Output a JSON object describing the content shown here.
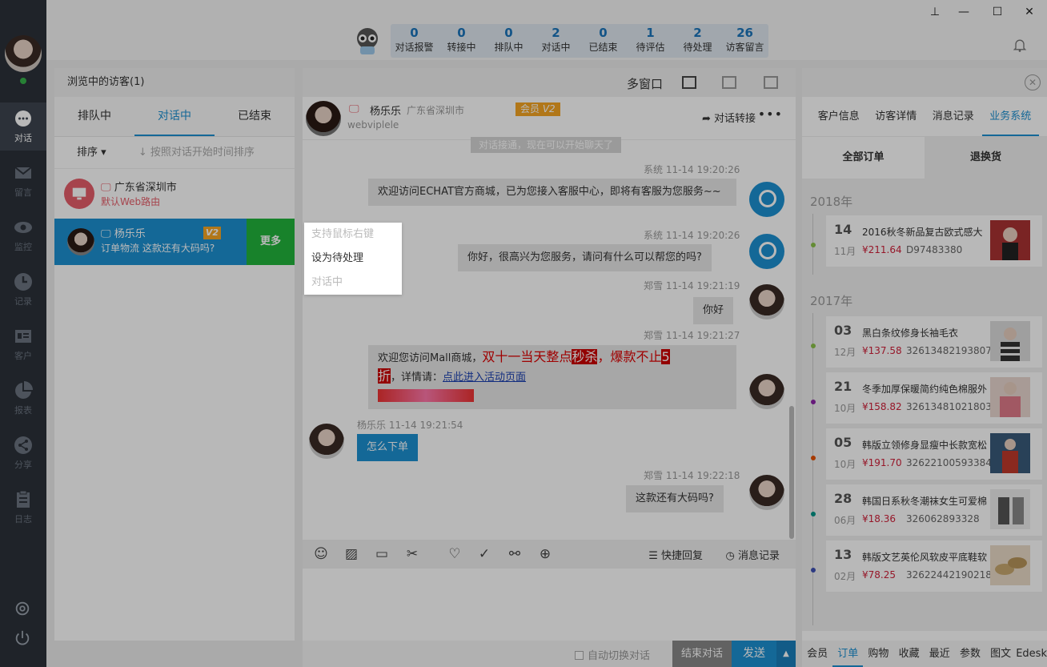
{
  "nav": {
    "items": [
      {
        "label": "对话",
        "icon": "chat-icon"
      },
      {
        "label": "留言",
        "icon": "mail-icon"
      },
      {
        "label": "监控",
        "icon": "eye-icon"
      },
      {
        "label": "记录",
        "icon": "clock-icon"
      },
      {
        "label": "客户",
        "icon": "contact-card-icon"
      },
      {
        "label": "报表",
        "icon": "pie-chart-icon"
      },
      {
        "label": "分享",
        "icon": "share-icon"
      },
      {
        "label": "日志",
        "icon": "clipboard-icon"
      }
    ]
  },
  "stats": [
    {
      "num": "0",
      "label": "对话报警"
    },
    {
      "num": "0",
      "label": "转接中"
    },
    {
      "num": "0",
      "label": "排队中"
    },
    {
      "num": "2",
      "label": "对话中"
    },
    {
      "num": "0",
      "label": "已结束"
    },
    {
      "num": "1",
      "label": "待评估"
    },
    {
      "num": "2",
      "label": "待处理"
    },
    {
      "num": "26",
      "label": "访客留言"
    }
  ],
  "visitors": {
    "title": "浏览中的访客(1)",
    "tabs": [
      "排队中",
      "对话中",
      "已结束"
    ],
    "sort_label": "排序",
    "sort_hint": "按照对话开始时间排序",
    "row1": {
      "name": "广东省深圳市",
      "sub": "默认Web路由"
    },
    "row2": {
      "name": "杨乐乐",
      "sub": "订单物流 这款还有大码吗?",
      "badge": "V2",
      "more": "更多"
    }
  },
  "context_menu": {
    "item1": "支持鼠标右键",
    "item2": "设为待处理",
    "item3": "对话中"
  },
  "chat": {
    "multi_window": "多窗口",
    "user_name": "杨乐乐",
    "user_location": "广东省深圳市",
    "vip_label": "会员",
    "vip_level": "V2",
    "user_id": "webviplele",
    "transfer_label": "对话转接",
    "system_note": "对话接通，现在可以开始聊天了",
    "messages": [
      {
        "meta": "系统 11-14 19:20:26",
        "text": "欢迎访问ECHAT官方商城，已为您接入客服中心，即将有客服为您服务~~"
      },
      {
        "meta": "系统 11-14 19:20:26",
        "text": "你好，很高兴为您服务，请问有什么可以帮您的吗?"
      },
      {
        "meta": "郑雪 11-14 19:21:19",
        "text": "你好"
      },
      {
        "meta": "郑雪 11-14 19:21:27",
        "text_a": "欢迎您访问Mall商城，",
        "text_b": "双十一当天整点",
        "text_c": "秒杀",
        "text_d": "，爆款不止",
        "text_e": "5",
        "text_f": "折",
        "text_g": "，详情请：",
        "link": "点此进入活动页面"
      },
      {
        "meta": "杨乐乐 11-14 19:21:54",
        "text": "怎么下单"
      },
      {
        "meta": "郑雪 11-14 19:22:18",
        "text": "这款还有大码吗?"
      }
    ],
    "quick_reply": "快捷回复",
    "history": "消息记录",
    "auto_switch": "自动切换对话",
    "end_label": "结束对话",
    "send_label": "发送"
  },
  "right": {
    "tabs": [
      "客户信息",
      "访客详情",
      "消息记录",
      "业务系统"
    ],
    "order_tabs": [
      "全部订单",
      "退换货"
    ],
    "year1": "2018年",
    "year2": "2017年",
    "orders": [
      {
        "day": "14",
        "month": "11月",
        "name": "2016秋冬新品复古欧式感大",
        "price": "¥211.64",
        "no": "D97483380",
        "dot": "#8bc34a"
      },
      {
        "day": "03",
        "month": "12月",
        "name": "黑白条纹修身长袖毛衣",
        "price": "¥137.58",
        "no": "32613482193807",
        "dot": "#8bc34a"
      },
      {
        "day": "21",
        "month": "10月",
        "name": "冬季加厚保暖简约纯色棉服外",
        "price": "¥158.82",
        "no": "32613481021803",
        "dot": "#8e24aa"
      },
      {
        "day": "05",
        "month": "10月",
        "name": "韩版立领修身显瘦中长款宽松",
        "price": "¥191.70",
        "no": "32622100593384",
        "dot": "#e65100"
      },
      {
        "day": "28",
        "month": "06月",
        "name": "韩国日系秋冬潮袜女生可爱棉",
        "price": "¥18.36",
        "no": "326062893328",
        "dot": "#009688"
      },
      {
        "day": "13",
        "month": "02月",
        "name": "韩版文艺英伦风软皮平底鞋软",
        "price": "¥78.25",
        "no": "32622442190218",
        "dot": "#3f51b5"
      }
    ],
    "bottom_tabs": [
      "会员",
      "订单",
      "购物",
      "收藏",
      "最近",
      "参数",
      "图文",
      "Edesk"
    ]
  }
}
